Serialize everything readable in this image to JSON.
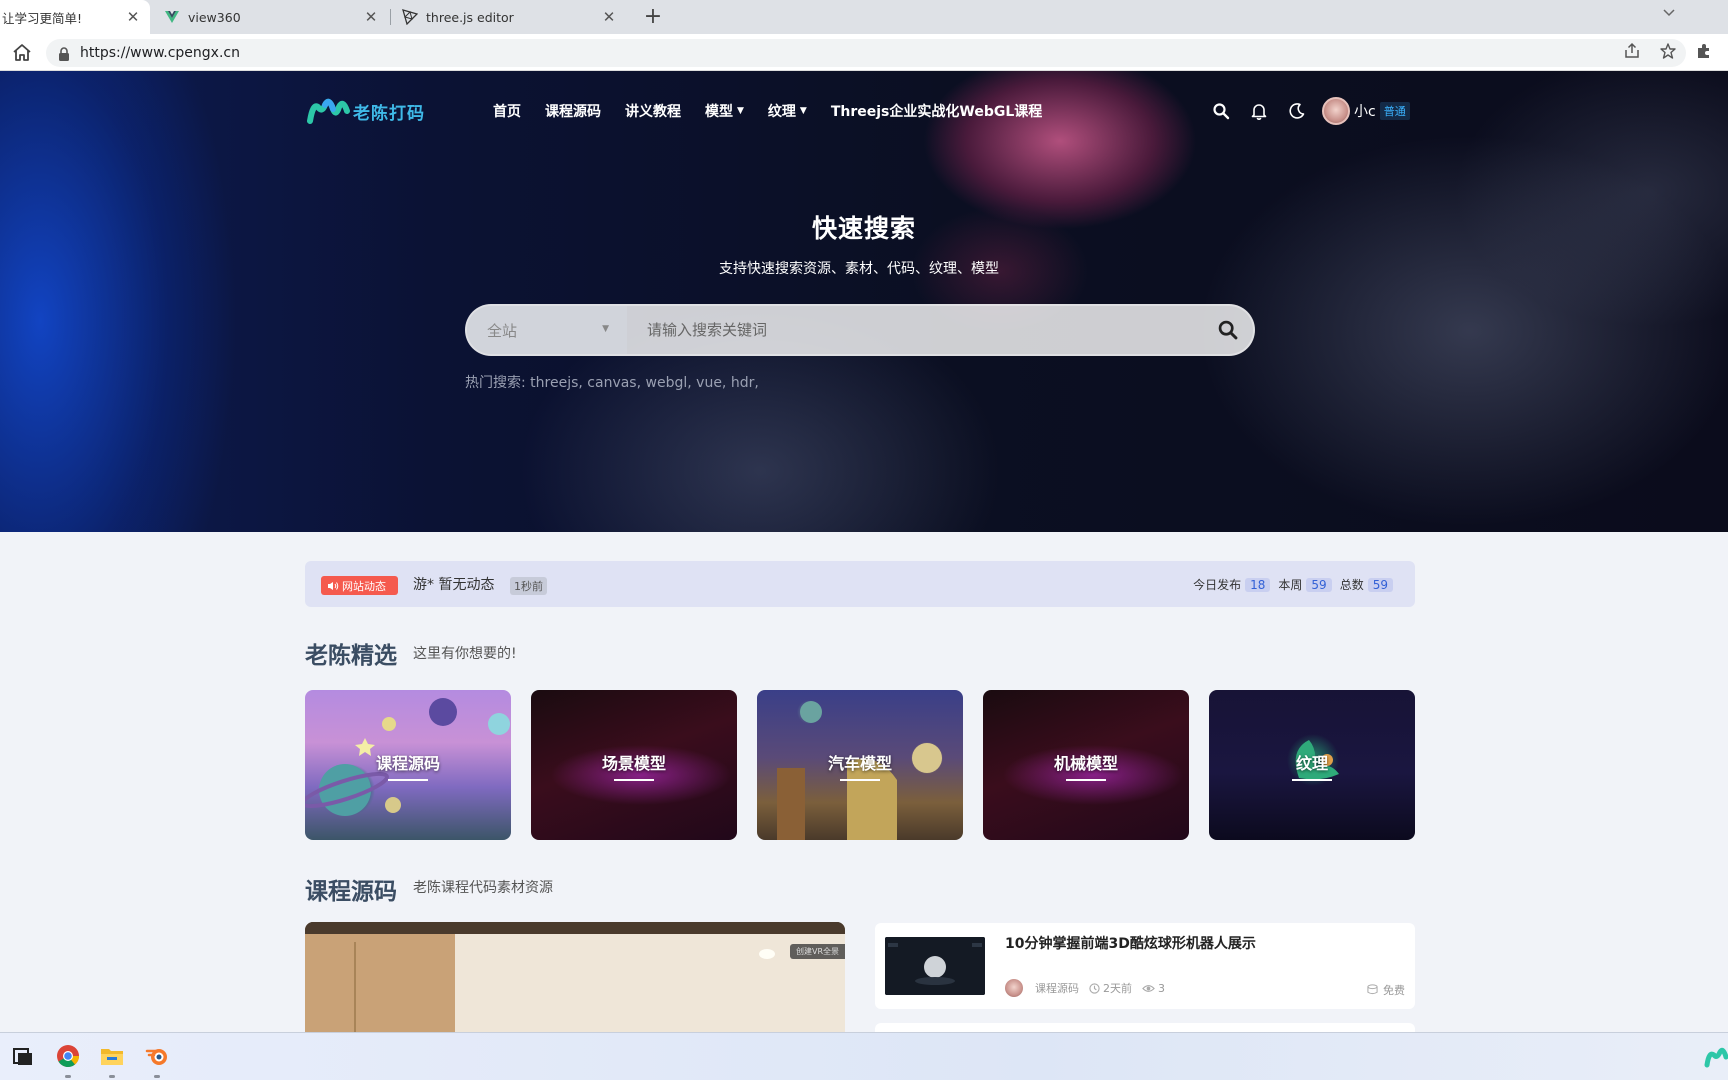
{
  "browser": {
    "tabs": [
      {
        "title": "让学习更简单!",
        "close": "✕",
        "active": true
      },
      {
        "title": "view360",
        "close": "✕",
        "active": false
      },
      {
        "title": "three.js editor",
        "close": "✕",
        "active": false
      }
    ],
    "new_tab": "+",
    "url": "https://www.cpengx.cn"
  },
  "nav": {
    "logo_text": "老陈打码",
    "menu": [
      {
        "label": "首页"
      },
      {
        "label": "课程源码"
      },
      {
        "label": "讲义教程"
      },
      {
        "label": "模型",
        "caret": "▼"
      },
      {
        "label": "纹理",
        "caret": "▼"
      },
      {
        "label": "Threejs企业实战化WebGL课程"
      }
    ],
    "user_name": "小c",
    "user_level": "普通"
  },
  "hero": {
    "title": "快速搜索",
    "subtitle": "支持快速搜索资源、素材、代码、纹理、模型",
    "scope": "全站",
    "scope_caret": "▼",
    "placeholder": "请输入搜索关键词",
    "hot_label": "热门搜索:",
    "hot_terms": [
      "threejs,",
      "canvas,",
      "webgl,",
      "vue,",
      "hdr,"
    ]
  },
  "notice": {
    "tag": "网站动态",
    "text": "游* 暂无动态",
    "time": "1秒前",
    "today_label": "今日发布",
    "today_value": "18",
    "week_label": "本周",
    "week_value": "59",
    "total_label": "总数",
    "total_value": "59"
  },
  "featured": {
    "title": "老陈精选",
    "subtitle": "这里有你想要的!",
    "categories": [
      "课程源码",
      "场景模型",
      "汽车模型",
      "机械模型",
      "纹理"
    ]
  },
  "courses": {
    "title": "课程源码",
    "subtitle": "老陈课程代码素材资源",
    "feature_tag": "创建VR全景",
    "post": {
      "title": "10分钟掌握前端3D酷炫球形机器人展示",
      "category": "课程源码",
      "time": "2天前",
      "views": "3",
      "price": "免费"
    }
  }
}
